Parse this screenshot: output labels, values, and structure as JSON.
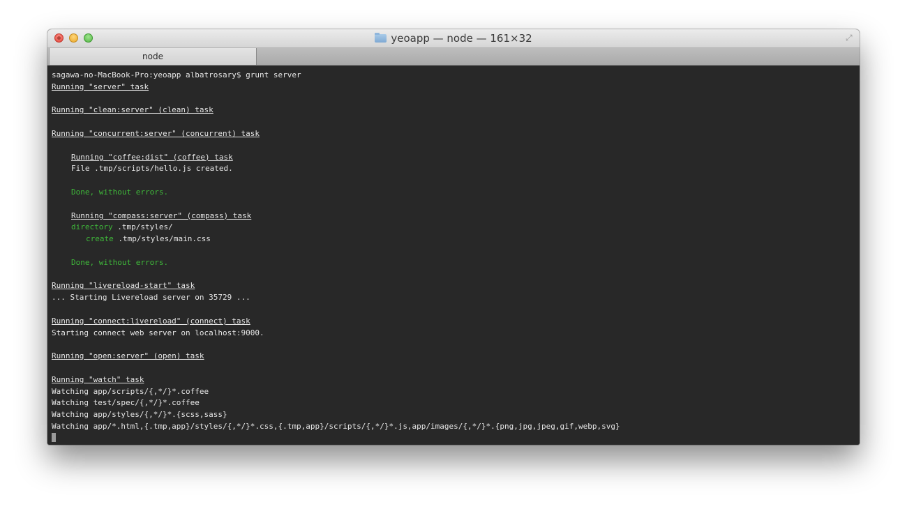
{
  "window": {
    "title": "yeoapp — node — 161×32",
    "tab_label": "node"
  },
  "terminal": {
    "lines": [
      "sagawa-no-MacBook-Pro:yeoapp albatrosary$ grunt server",
      "Running \"server\" task",
      "Running \"clean:server\" (clean) task",
      "Running \"concurrent:server\" (concurrent) task",
      "Running \"coffee:dist\" (coffee) task",
      "File .tmp/scripts/hello.js created.",
      "Done, without errors.",
      "Running \"compass:server\" (compass) task",
      "directory",
      ".tmp/styles/",
      "create",
      ".tmp/styles/main.css",
      "Done, without errors.",
      "Running \"livereload-start\" task",
      "... Starting Livereload server on 35729 ...",
      "Running \"connect:livereload\" (connect) task",
      "Starting connect web server on localhost:9000.",
      "Running \"open:server\" (open) task",
      "Running \"watch\" task",
      "Watching app/scripts/{,*/}*.coffee",
      "Watching test/spec/{,*/}*.coffee",
      "Watching app/styles/{,*/}*.{scss,sass}",
      "Watching app/*.html,{.tmp,app}/styles/{,*/}*.css,{.tmp,app}/scripts/{,*/}*.js,app/images/{,*/}*.{png,jpg,jpeg,gif,webp,svg}"
    ]
  },
  "icons": {
    "close": "close-button-icon",
    "minimize": "minimize-button-icon",
    "zoom": "zoom-button-icon",
    "folder": "folder-icon",
    "fullscreen": "fullscreen-icon"
  },
  "colors": {
    "terminal_bg": "#282828",
    "terminal_fg": "#e6e6e6",
    "success_green": "#3fb93a"
  }
}
